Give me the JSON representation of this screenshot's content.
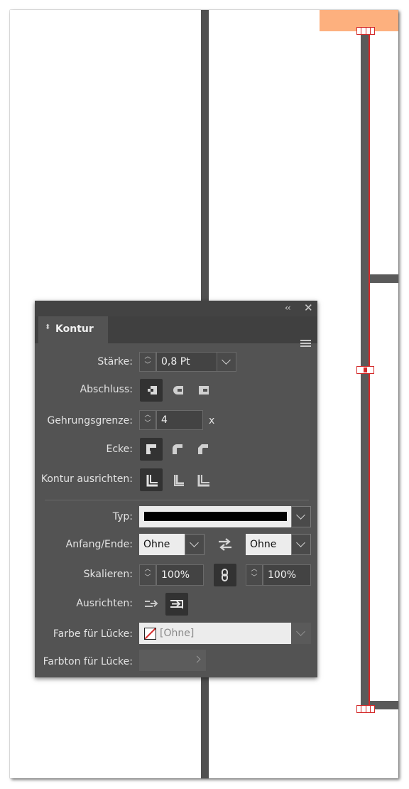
{
  "panel": {
    "title": "Kontur",
    "tab_arrows": "⬍",
    "collapse_label": "‹‹",
    "close_label": "✕"
  },
  "staerke": {
    "label": "Stärke:",
    "value": "0,8 Pt"
  },
  "abschluss": {
    "label": "Abschluss:",
    "options": [
      "flat-cap",
      "round-cap",
      "projecting-cap"
    ],
    "selected": "flat-cap"
  },
  "gehrungsgrenze": {
    "label": "Gehrungsgrenze:",
    "value": "4",
    "unit": "x"
  },
  "ecke": {
    "label": "Ecke:",
    "options": [
      "miter-join",
      "round-join",
      "bevel-join"
    ],
    "selected": "miter-join"
  },
  "kontur_ausrichten": {
    "label": "Kontur ausrichten:",
    "options": [
      "align-center",
      "align-inside",
      "align-outside"
    ],
    "selected": "align-center"
  },
  "typ": {
    "label": "Typ:"
  },
  "anfang_ende": {
    "label": "Anfang/Ende:",
    "start_value": "Ohne",
    "end_value": "Ohne"
  },
  "skalieren": {
    "label": "Skalieren:",
    "start_value": "100%",
    "end_value": "100%"
  },
  "ausrichten": {
    "label": "Ausrichten:",
    "options": [
      "extend-beyond",
      "place-at-end"
    ],
    "selected": "place-at-end"
  },
  "farbe_luecke": {
    "label": "Farbe für Lücke:",
    "value": "[Ohne]"
  },
  "farbton_luecke": {
    "label": "Farbton für Lücke:"
  },
  "colors": {
    "panel_bg": "#535353",
    "topbar_bg": "#434343",
    "highlight_orange": "#fdb07e",
    "selection_red": "#d42a2a",
    "rule_gray": "#5a5a5a"
  }
}
